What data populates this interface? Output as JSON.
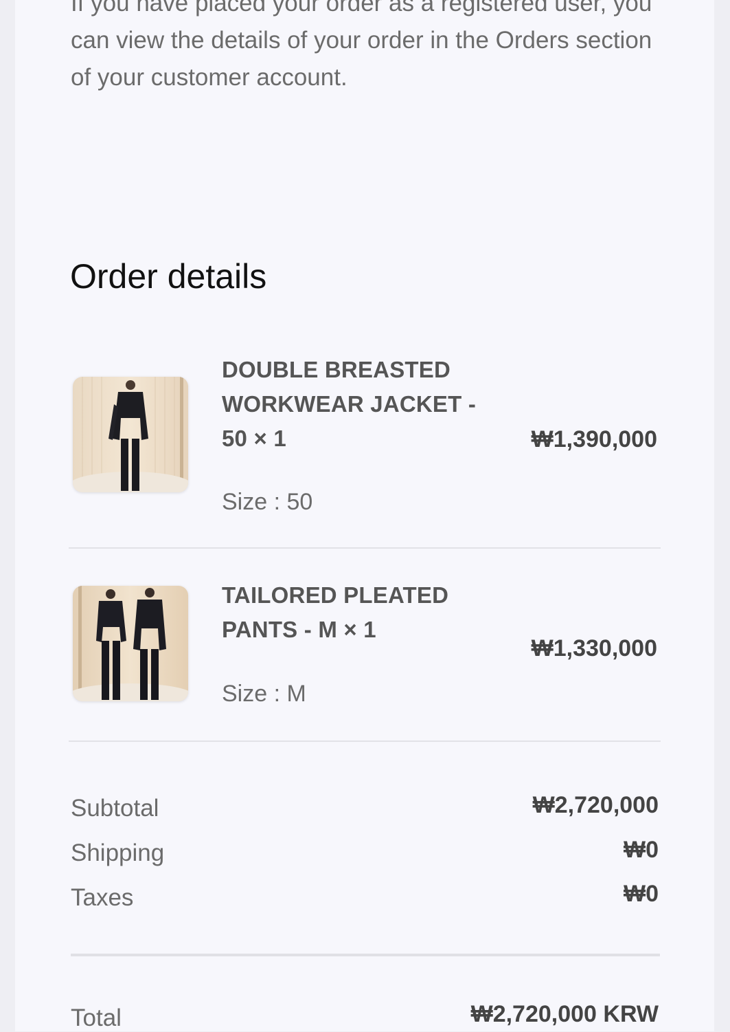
{
  "intro_text": "If you have placed your order as a registered user, you can view the details of your order in the Orders section of your customer account.",
  "order_details": {
    "title": "Order details",
    "items": [
      {
        "name": "DOUBLE BREASTED WORKWEAR JACKET - 50 × 1",
        "size": "Size : 50",
        "price": "₩1,390,000"
      },
      {
        "name": "TAILORED PLEATED PANTS - M × 1",
        "size": "Size : M",
        "price": "₩1,330,000"
      }
    ]
  },
  "summary": {
    "subtotal_label": "Subtotal",
    "subtotal_value": "₩2,720,000",
    "shipping_label": "Shipping",
    "shipping_value": "₩0",
    "taxes_label": "Taxes",
    "taxes_value": "₩0",
    "total_label": "Total",
    "total_value": "₩2,720,000 KRW"
  },
  "colors": {
    "background": "#f7f7fc",
    "heading": "#111111",
    "muted_text": "#6b6b6b",
    "price_text": "#444444",
    "divider": "#e2e2e7"
  }
}
